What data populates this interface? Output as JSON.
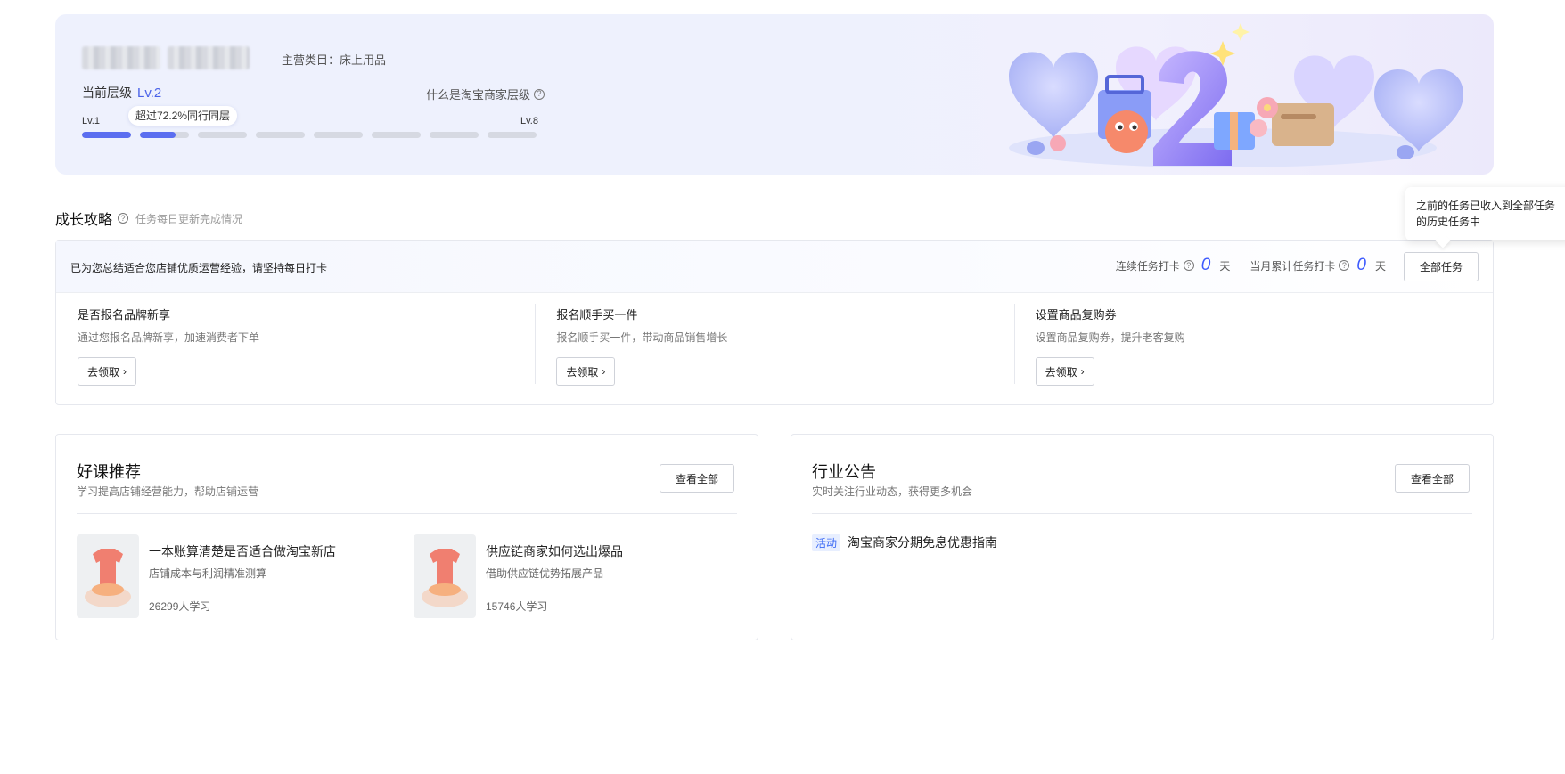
{
  "banner": {
    "main_category_label": "主营类目：",
    "main_category_value": "床上用品",
    "current_level_label": "当前层级",
    "current_level_value": "Lv.2",
    "what_is_level": "什么是淘宝商家层级",
    "progress_tip": "超过72.2%同行同层",
    "level_min": "Lv.1",
    "level_max": "Lv.8",
    "progress_segments": [
      1.0,
      0.72,
      0,
      0,
      0,
      0,
      0,
      0
    ],
    "accent_color": "#5b6ef0"
  },
  "growth": {
    "title": "成长攻略",
    "subtitle": "任务每日更新完成情况",
    "head_text": "已为您总结适合您店铺优质运营经验，请坚持每日打卡",
    "streak_label": "连续任务打卡",
    "streak_value": "0",
    "streak_unit": "天",
    "month_label": "当月累计任务打卡",
    "month_value": "0",
    "month_unit": "天",
    "all_tasks_button": "全部任务",
    "tooltip": "之前的任务已收入到全部任务的历史任务中",
    "tasks": [
      {
        "title": "是否报名品牌新享",
        "desc": "通过您报名品牌新享，加速消费者下单",
        "button": "去领取"
      },
      {
        "title": "报名顺手买一件",
        "desc": "报名顺手买一件，带动商品销售增长",
        "button": "去领取"
      },
      {
        "title": "设置商品复购券",
        "desc": "设置商品复购券，提升老客复购",
        "button": "去领取"
      }
    ]
  },
  "courses": {
    "title": "好课推荐",
    "subtitle": "学习提高店铺经营能力，帮助店铺运营",
    "view_all": "查看全部",
    "items": [
      {
        "title": "一本账算清楚是否适合做淘宝新店",
        "desc": "店铺成本与利润精准测算",
        "count": "26299人学习"
      },
      {
        "title": "供应链商家如何选出爆品",
        "desc": "借助供应链优势拓展产品",
        "count": "15746人学习"
      }
    ]
  },
  "announcements": {
    "title": "行业公告",
    "subtitle": "实时关注行业动态，获得更多机会",
    "view_all": "查看全部",
    "items": [
      {
        "tag": "活动",
        "text": "淘宝商家分期免息优惠指南"
      }
    ]
  }
}
